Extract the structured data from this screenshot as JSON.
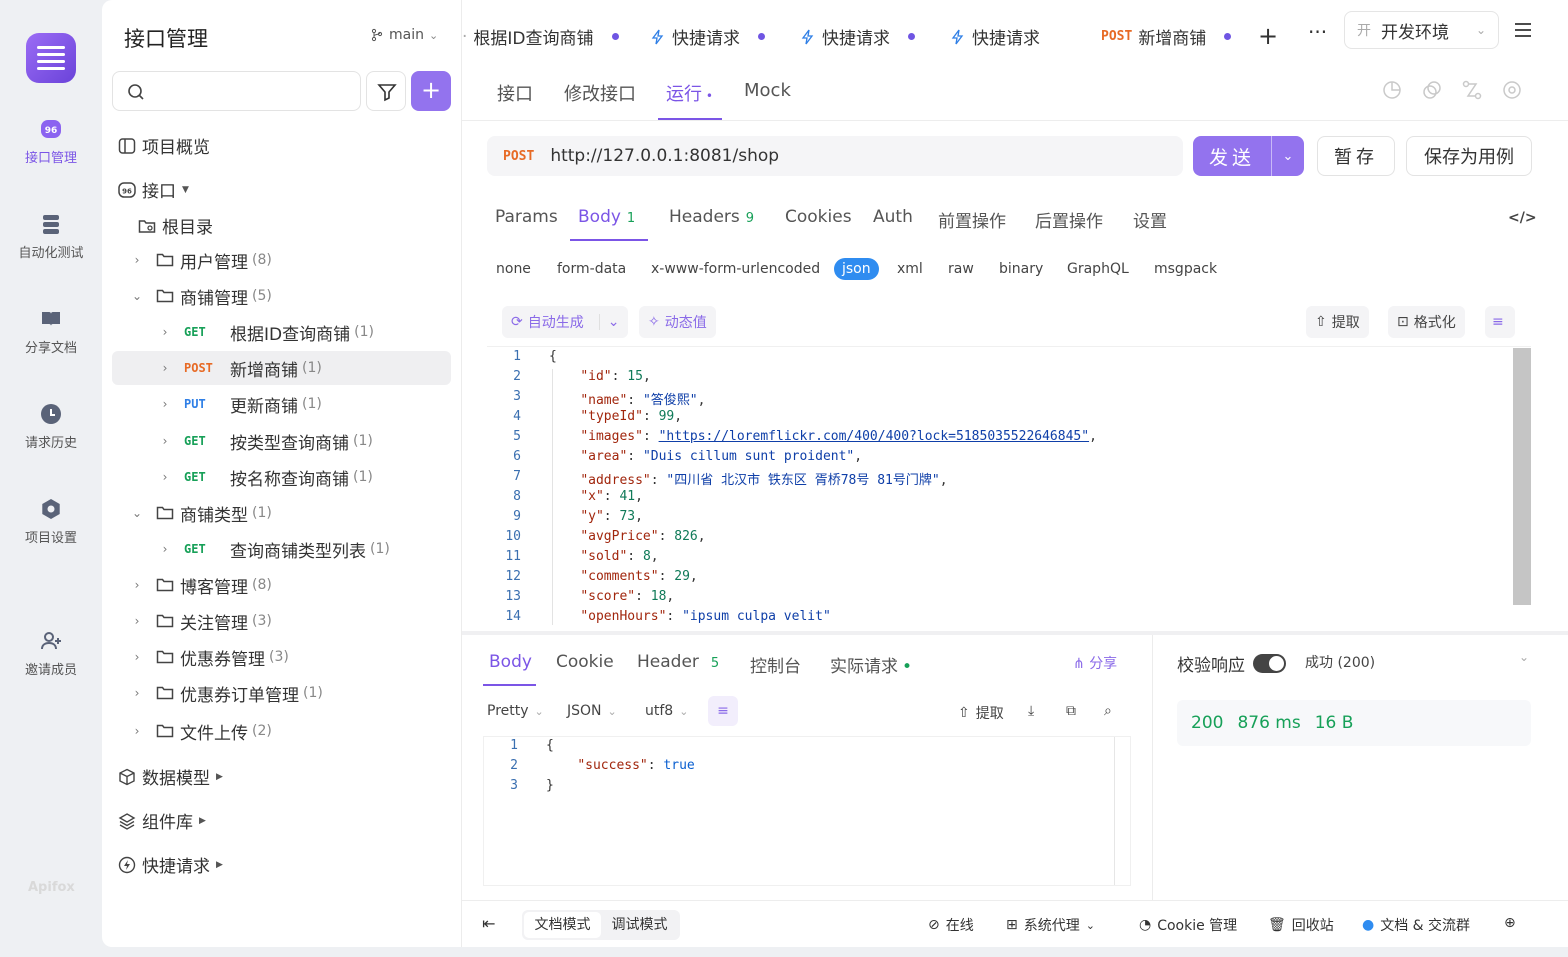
{
  "app": {
    "name": "Apifox"
  },
  "rail": {
    "items": [
      {
        "label": "接口管理",
        "icon": "api-icon",
        "active": true
      },
      {
        "label": "自动化测试",
        "icon": "database-icon",
        "active": false
      },
      {
        "label": "分享文档",
        "icon": "book-icon",
        "active": false
      },
      {
        "label": "请求历史",
        "icon": "clock-icon",
        "active": false
      },
      {
        "label": "项目设置",
        "icon": "gear-icon",
        "active": false
      },
      {
        "label": "邀请成员",
        "icon": "add-user-icon",
        "active": false
      }
    ],
    "footer": "Apifox"
  },
  "sidebar": {
    "title": "接口管理",
    "branch": "main",
    "search": {
      "placeholder": ""
    },
    "overview": "项目概览",
    "api_section": "接口",
    "root": "根目录",
    "tree": [
      {
        "type": "folder",
        "label": "用户管理",
        "count": "(8)",
        "expanded": false,
        "level": 1
      },
      {
        "type": "folder",
        "label": "商铺管理",
        "count": "(5)",
        "expanded": true,
        "level": 1
      },
      {
        "type": "api",
        "method": "GET",
        "label": "根据ID查询商铺",
        "count": "(1)",
        "level": 2
      },
      {
        "type": "api",
        "method": "POST",
        "label": "新增商铺",
        "count": "(1)",
        "level": 2,
        "selected": true
      },
      {
        "type": "api",
        "method": "PUT",
        "label": "更新商铺",
        "count": "(1)",
        "level": 2
      },
      {
        "type": "api",
        "method": "GET",
        "label": "按类型查询商铺",
        "count": "(1)",
        "level": 2
      },
      {
        "type": "api",
        "method": "GET",
        "label": "按名称查询商铺",
        "count": "(1)",
        "level": 2
      },
      {
        "type": "folder",
        "label": "商铺类型",
        "count": "(1)",
        "expanded": true,
        "level": 1
      },
      {
        "type": "api",
        "method": "GET",
        "label": "查询商铺类型列表",
        "count": "(1)",
        "level": 2
      },
      {
        "type": "folder",
        "label": "博客管理",
        "count": "(8)",
        "expanded": false,
        "level": 1
      },
      {
        "type": "folder",
        "label": "关注管理",
        "count": "(3)",
        "expanded": false,
        "level": 1
      },
      {
        "type": "folder",
        "label": "优惠券管理",
        "count": "(3)",
        "expanded": false,
        "level": 1
      },
      {
        "type": "folder",
        "label": "优惠券订单管理",
        "count": "(1)",
        "expanded": false,
        "level": 1
      },
      {
        "type": "folder",
        "label": "文件上传",
        "count": "(2)",
        "expanded": false,
        "level": 1
      }
    ],
    "bottom_sections": [
      "数据模型",
      "组件库",
      "快捷请求"
    ]
  },
  "tabs": [
    {
      "method": "",
      "label": "根据ID查询商铺",
      "icon": ""
    },
    {
      "method": "",
      "label": "快捷请求",
      "icon": "bolt-icon"
    },
    {
      "method": "",
      "label": "快捷请求",
      "icon": "bolt-icon"
    },
    {
      "method": "",
      "label": "快捷请求",
      "icon": "bolt-icon"
    },
    {
      "method": "POST",
      "label": "新增商铺",
      "icon": "",
      "active": true
    }
  ],
  "environment": {
    "prefix": "开",
    "label": "开发环境"
  },
  "subtabs": [
    "接口",
    "修改接口",
    "运行",
    "Mock"
  ],
  "request": {
    "method": "POST",
    "url": "http://127.0.0.1:8081/shop",
    "send_label": "发送",
    "save_label": "暂存",
    "save_case_label": "保存为用例"
  },
  "req_tabs": [
    {
      "label": "Params",
      "count": ""
    },
    {
      "label": "Body",
      "count": "1"
    },
    {
      "label": "Headers",
      "count": "9"
    },
    {
      "label": "Cookies",
      "count": ""
    },
    {
      "label": "Auth",
      "count": ""
    },
    {
      "label": "前置操作",
      "count": ""
    },
    {
      "label": "后置操作",
      "count": ""
    },
    {
      "label": "设置",
      "count": ""
    }
  ],
  "body_types": [
    "none",
    "form-data",
    "x-www-form-urlencoded",
    "json",
    "xml",
    "raw",
    "binary",
    "GraphQL",
    "msgpack"
  ],
  "body_type_active": "json",
  "body_tools": {
    "auto_gen": "自动生成",
    "dynamic": "动态值",
    "extract": "提取",
    "format": "格式化"
  },
  "body_code": [
    {
      "n": "1",
      "t": "{"
    },
    {
      "n": "2",
      "k": "\"id\"",
      "v": "15",
      "vt": "n"
    },
    {
      "n": "3",
      "k": "\"name\"",
      "v": "\"答俊熙\"",
      "vt": "s"
    },
    {
      "n": "4",
      "k": "\"typeId\"",
      "v": "99",
      "vt": "n"
    },
    {
      "n": "5",
      "k": "\"images\"",
      "v": "\"https://loremflickr.com/400/400?lock=5185035522646845\"",
      "vt": "u"
    },
    {
      "n": "6",
      "k": "\"area\"",
      "v": "\"Duis cillum sunt proident\"",
      "vt": "s"
    },
    {
      "n": "7",
      "k": "\"address\"",
      "v": "\"四川省 北汉市 铁东区 胥桥78号 81号门牌\"",
      "vt": "s"
    },
    {
      "n": "8",
      "k": "\"x\"",
      "v": "41",
      "vt": "n"
    },
    {
      "n": "9",
      "k": "\"y\"",
      "v": "73",
      "vt": "n"
    },
    {
      "n": "10",
      "k": "\"avgPrice\"",
      "v": "826",
      "vt": "n"
    },
    {
      "n": "11",
      "k": "\"sold\"",
      "v": "8",
      "vt": "n"
    },
    {
      "n": "12",
      "k": "\"comments\"",
      "v": "29",
      "vt": "n"
    },
    {
      "n": "13",
      "k": "\"score\"",
      "v": "18",
      "vt": "n"
    },
    {
      "n": "14",
      "k": "\"openHours\"",
      "v": "\"ipsum culpa velit\"",
      "vt": "s"
    }
  ],
  "response": {
    "tabs": [
      {
        "label": "Body",
        "count": ""
      },
      {
        "label": "Cookie",
        "count": ""
      },
      {
        "label": "Header",
        "count": "5"
      },
      {
        "label": "控制台",
        "count": ""
      },
      {
        "label": "实际请求",
        "count": ""
      }
    ],
    "share": "分享",
    "format": "Pretty",
    "lang": "JSON",
    "encoding": "utf8",
    "extract": "提取",
    "code": [
      {
        "n": "1",
        "t": "{"
      },
      {
        "n": "2",
        "k": "\"success\"",
        "v": "true"
      },
      {
        "n": "3",
        "t": "}"
      }
    ],
    "validate_label": "校验响应",
    "validate_result": "成功 (200)",
    "status": "200",
    "time": "876 ms",
    "size": "16 B"
  },
  "footer": {
    "doc_mode": "文档模式",
    "debug_mode": "调试模式",
    "online": "在线",
    "proxy": "系统代理",
    "cookie": "Cookie 管理",
    "trash": "回收站",
    "community": "文档 & 交流群"
  },
  "colors": {
    "accent": "#7b55e6",
    "get": "#17a058",
    "post": "#e76a25",
    "put": "#2f7fe6"
  }
}
